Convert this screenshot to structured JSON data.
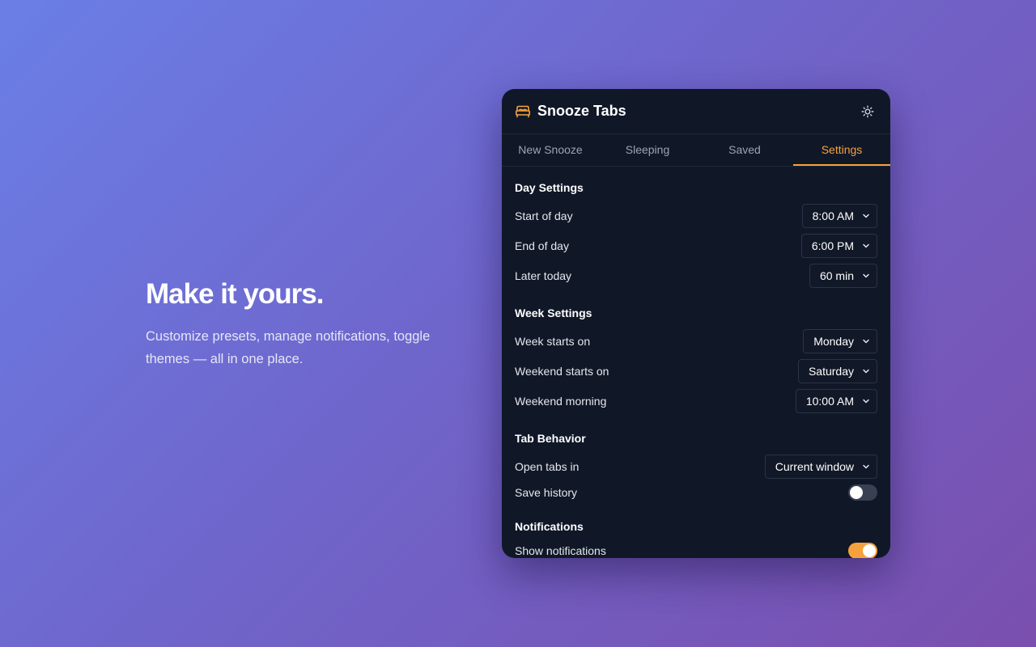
{
  "hero": {
    "title": "Make it yours.",
    "subtitle": "Customize presets, manage notifications, toggle themes — all in one place."
  },
  "app": {
    "title": "Snooze Tabs",
    "logo_icon": "bed-icon",
    "theme_icon": "sun-icon",
    "accent_color": "#f6a23c"
  },
  "tabs": [
    {
      "label": "New Snooze",
      "active": false
    },
    {
      "label": "Sleeping",
      "active": false
    },
    {
      "label": "Saved",
      "active": false
    },
    {
      "label": "Settings",
      "active": true
    }
  ],
  "settings": {
    "day": {
      "title": "Day Settings",
      "start_label": "Start of day",
      "start_value": "8:00 AM",
      "end_label": "End of day",
      "end_value": "6:00 PM",
      "later_label": "Later today",
      "later_value": "60 min"
    },
    "week": {
      "title": "Week Settings",
      "start_label": "Week starts on",
      "start_value": "Monday",
      "weekend_label": "Weekend starts on",
      "weekend_value": "Saturday",
      "morning_label": "Weekend morning",
      "morning_value": "10:00 AM"
    },
    "tab_behavior": {
      "title": "Tab Behavior",
      "open_label": "Open tabs in",
      "open_value": "Current window",
      "history_label": "Save history",
      "history_on": false
    },
    "notifications": {
      "title": "Notifications",
      "show_label": "Show notifications",
      "show_on": true
    }
  }
}
